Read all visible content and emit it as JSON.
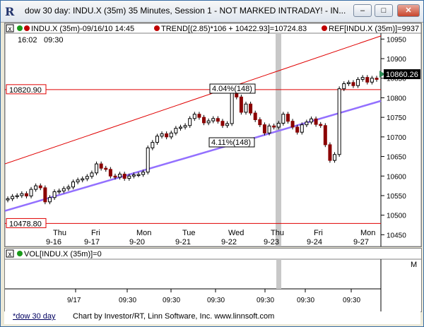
{
  "window": {
    "title": "dow 30 day: INDU.X (35m) 35 Minutes, Session 1 - NOT MARKED INTRADAY! - IN...",
    "buttons": {
      "minimize": "–",
      "maximize": "□",
      "close": "✕"
    }
  },
  "legend": {
    "symbol": "INDU.X (35m)-09/16/10 14:45",
    "trend": "TREND[(2.85)*106 + 10422.93]=10724.83",
    "ref": "REF[INDU.X (35m)]=9937",
    "time_left": "16:02",
    "time_right": "09:30"
  },
  "colors": {
    "up": "#000000",
    "down": "#8b0000",
    "trend": "#e00000",
    "reg": "#9370ff",
    "ref": "#e00000",
    "highlight": "#c8c8c8",
    "last_marker": "#2e8b57"
  },
  "chart_data": {
    "type": "candlestick",
    "title": "",
    "ylim": [
      10420,
      10965
    ],
    "y_ticks": [
      10450,
      10500,
      10550,
      10600,
      10650,
      10700,
      10750,
      10800,
      10850,
      10900,
      10950
    ],
    "day_labels": [
      {
        "day": "Thu",
        "date": "9-16"
      },
      {
        "day": "Fri",
        "date": "9-17"
      },
      {
        "day": "Mon",
        "date": "9-20"
      },
      {
        "day": "Tue",
        "date": "9-21"
      },
      {
        "day": "Wed",
        "date": "9-22"
      },
      {
        "day": "Thu",
        "date": "9-23"
      },
      {
        "day": "Fri",
        "date": "9-24"
      },
      {
        "day": "Mon",
        "date": "9-27"
      }
    ],
    "ref_levels": [
      10820.9,
      10478.8
    ],
    "last_price": 10860.26,
    "annotations": [
      "4.04%(148)",
      "4.11%(148)"
    ],
    "trend_line": {
      "start": 10631,
      "end": 10958
    },
    "regression_line": {
      "start": 10511,
      "end": 10792
    },
    "closes": [
      10542,
      10548,
      10550,
      10555,
      10549,
      10566,
      10575,
      10570,
      10534,
      10545,
      10560,
      10562,
      10568,
      10572,
      10585,
      10590,
      10593,
      10599,
      10608,
      10631,
      10620,
      10617,
      10600,
      10597,
      10605,
      10594,
      10600,
      10603,
      10604,
      10610,
      10672,
      10686,
      10702,
      10708,
      10700,
      10710,
      10722,
      10725,
      10729,
      10747,
      10758,
      10750,
      10736,
      10741,
      10747,
      10740,
      10729,
      10734,
      10826,
      10802,
      10763,
      10784,
      10761,
      10744,
      10731,
      10710,
      10728,
      10725,
      10735,
      10758,
      10740,
      10725,
      10712,
      10731,
      10738,
      10746,
      10732,
      10729,
      10680,
      10640,
      10655,
      10823,
      10836,
      10839,
      10831,
      10847,
      10852,
      10840,
      10850,
      10847
    ],
    "volume_ticks": [
      "9/17",
      "09:30",
      "09:30",
      "09:30",
      "09:30",
      "09:30",
      "09:30"
    ]
  },
  "volume": {
    "label": "VOL[INDU.X (35m)]=0",
    "scale_label": "M"
  },
  "footer": {
    "tab": "*dow 30 day",
    "credit": "Chart by Investor/RT, Linn Software, Inc. www.linnsoft.com"
  }
}
